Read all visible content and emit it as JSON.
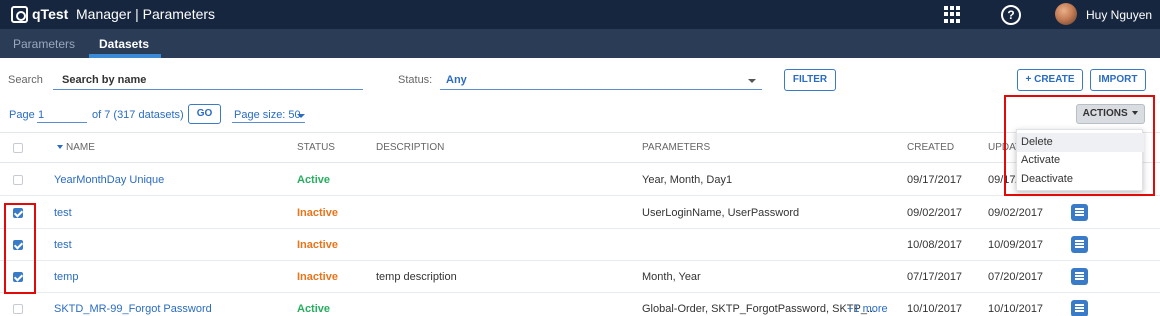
{
  "app": {
    "brand": "qTest",
    "title": "Manager | Parameters",
    "user": "Huy Nguyen",
    "help_symbol": "?"
  },
  "nav": {
    "tabs": [
      {
        "label": "Parameters",
        "active": false
      },
      {
        "label": "Datasets",
        "active": true
      }
    ]
  },
  "search": {
    "label": "Search",
    "placeholder": "Search by name",
    "status_label": "Status:",
    "status_value": "Any",
    "filter_button": "FILTER",
    "create_button": "+ CREATE",
    "import_button": "IMPORT"
  },
  "pagination": {
    "page_label": "Page",
    "page_value": "1",
    "of_text": "of 7 (317 datasets)",
    "go_button": "GO",
    "page_size": "Page size: 50"
  },
  "actions": {
    "button_label": "ACTIONS",
    "menu_items": [
      "Delete",
      "Activate",
      "Deactivate"
    ],
    "hovered_item": "Delete"
  },
  "table": {
    "columns": [
      "NAME",
      "STATUS",
      "DESCRIPTION",
      "PARAMETERS",
      "CREATED",
      "UPDATED"
    ],
    "sort_column": "NAME",
    "rows": [
      {
        "checked": false,
        "name": "YearMonthDay Unique",
        "status": "Active",
        "description": "",
        "parameters": "Year, Month, Day1",
        "more": "",
        "created": "09/17/2017",
        "updated": "09/17/2017",
        "show_doc": false
      },
      {
        "checked": true,
        "name": "test",
        "status": "Inactive",
        "description": "",
        "parameters": "UserLoginName, UserPassword",
        "more": "",
        "created": "09/02/2017",
        "updated": "09/02/2017",
        "show_doc": true
      },
      {
        "checked": true,
        "name": "test",
        "status": "Inactive",
        "description": "",
        "parameters": "",
        "more": "",
        "created": "10/08/2017",
        "updated": "10/09/2017",
        "show_doc": true
      },
      {
        "checked": true,
        "name": "temp",
        "status": "Inactive",
        "description": "temp description",
        "parameters": "Month, Year",
        "more": "",
        "created": "07/17/2017",
        "updated": "07/20/2017",
        "show_doc": true
      },
      {
        "checked": false,
        "name": "SKTD_MR-99_Forgot Password",
        "status": "Active",
        "description": "",
        "parameters": "Global-Order, SKTP_ForgotPassword, SKTP_...",
        "more": "+1 more",
        "created": "10/10/2017",
        "updated": "10/10/2017",
        "show_doc": true
      }
    ]
  },
  "colors": {
    "topbar": "#16263f",
    "navbar": "#2b3c57",
    "accent": "#2a6cc0",
    "active": "#27ae60",
    "inactive": "#e8741c",
    "highlight": "#e10a0a"
  }
}
